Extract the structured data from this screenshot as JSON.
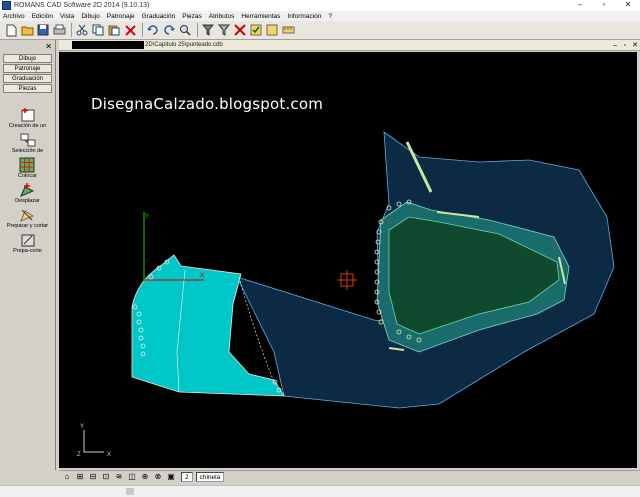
{
  "window": {
    "title": "ROMANS CAD Software 2D 2014 (9.10.13)",
    "minimize": "–",
    "maximize": "▫",
    "close": "✕"
  },
  "menu": [
    "Archivo",
    "Edición",
    "Vista",
    "Dibujo",
    "Patronaje",
    "Graduación",
    "Piezas",
    "Atributos",
    "Herramientas",
    "Información",
    "?"
  ],
  "toolbar_icons": [
    "new-file-icon",
    "open-folder-icon",
    "save-icon",
    "print-icon",
    "cut-icon",
    "copy-icon",
    "paste-icon",
    "delete-icon",
    "undo-icon",
    "redo-icon",
    "zoom-icon",
    "filter-icon",
    "filter-down-icon",
    "tool-x-icon",
    "check-icon",
    "note-icon",
    "measure-icon"
  ],
  "left_panel": {
    "close": "✕",
    "tabs": [
      "Dibujo",
      "Patronaje",
      "Graduación",
      "Piezas"
    ],
    "tools": [
      {
        "label": "Creación de un",
        "icon": "create-piece-icon"
      },
      {
        "label": "Selección de",
        "icon": "select-pieces-icon"
      },
      {
        "label": "Colocar",
        "icon": "place-grid-icon"
      },
      {
        "label": "Desplazar",
        "icon": "move-icon"
      },
      {
        "label": "Preparar y cortar",
        "icon": "prepare-cut-icon"
      },
      {
        "label": "Prepa-corte",
        "icon": "precut-icon"
      }
    ]
  },
  "document": {
    "path": "2D\\Capitulo 25\\punteado.cdb",
    "min": "–",
    "max": "▫",
    "close": "✕"
  },
  "canvas": {
    "watermark": "DisegnaCalzado.blogspot.com",
    "axis_y": "Y",
    "axis_x": "X",
    "axis_z": "Z",
    "bg": "#000000",
    "cyan": "#00c8c8",
    "navy": "#0d2a45",
    "green": "#0f4a30",
    "teal": "#1a6b6b"
  },
  "status": {
    "page": "2",
    "name": "chinela"
  }
}
